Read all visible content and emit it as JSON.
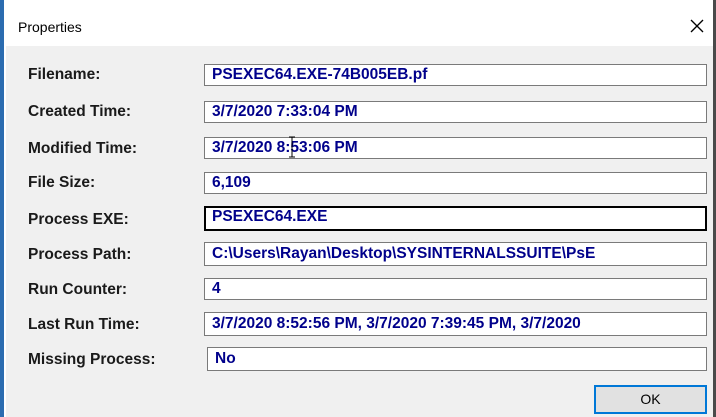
{
  "window": {
    "title": "Properties"
  },
  "fields": [
    {
      "label": "Filename:",
      "value": "PSEXEC64.EXE-74B005EB.pf"
    },
    {
      "label": "Created Time:",
      "value": "3/7/2020 7:33:04 PM"
    },
    {
      "label": "Modified Time:",
      "value": "3/7/2020 8:53:06 PM"
    },
    {
      "label": "File Size:",
      "value": "6,109"
    },
    {
      "label": "Process EXE:",
      "value": "PSEXEC64.EXE"
    },
    {
      "label": "Process Path:",
      "value": "C:\\Users\\Rayan\\Desktop\\SYSINTERNALSSUITE\\PsE"
    },
    {
      "label": "Run Counter:",
      "value": "4"
    },
    {
      "label": "Last Run Time:",
      "value": "3/7/2020 8:52:56 PM, 3/7/2020 7:39:45 PM, 3/7/2020"
    },
    {
      "label": "Missing Process:",
      "value": "No"
    }
  ],
  "buttons": {
    "ok_label": "OK"
  },
  "colors": {
    "value_text": "#00008b",
    "frame_accent": "#2b6cb0",
    "button_focus": "#0078d7"
  },
  "icons": {
    "close": "close-icon",
    "cursor": "text-cursor-ibeam-icon"
  }
}
